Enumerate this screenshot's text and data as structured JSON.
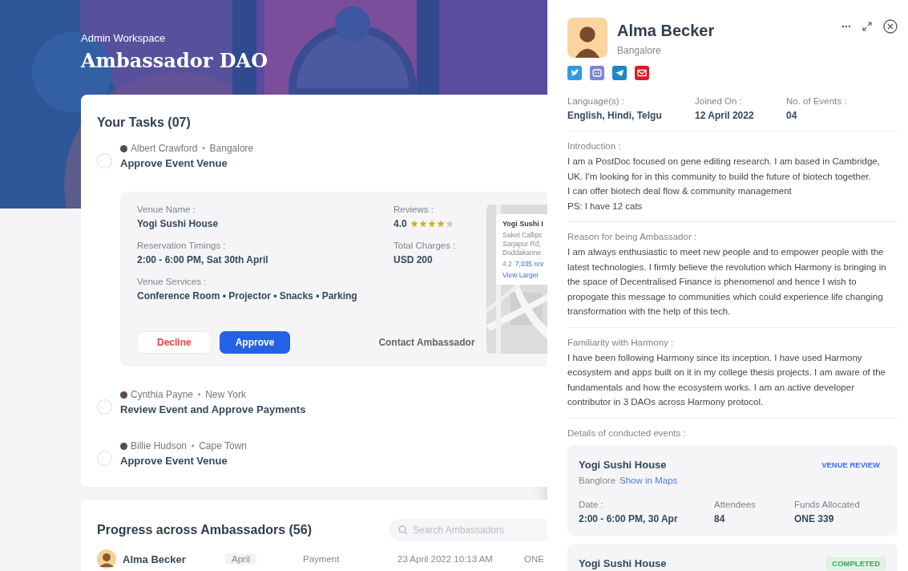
{
  "header": {
    "workspace": "Admin Workspace",
    "title": "Ambassador DAO"
  },
  "tasks_card": {
    "title": "Your Tasks (07)",
    "tasks": [
      {
        "person": "Albert Crawford",
        "separator": "•",
        "city": "Bangalore",
        "title": "Approve Event Venue",
        "checked": false,
        "details": {
          "venue_label": "Venue Name :",
          "venue": "Yogi Sushi House",
          "timing_label": "Reservation Timings :",
          "timing": "2:00 - 6:00 PM, Sat 30th April",
          "services_label": "Venue Services :",
          "services": "Conference Room • Projector • Snacks • Parking",
          "reviews_label": "Reviews :",
          "rating": "4.0",
          "stars": 4,
          "charges_label": "Total Charges :",
          "charges": "USD 200",
          "map_card": {
            "name": "Yogi Sushi I",
            "address": [
              "Saket Callipc",
              "Sarjapur Rd,",
              "Doddakanne"
            ],
            "rating": "4.2",
            "reviews": "7,035 rev",
            "link": "View Larger"
          },
          "decline": "Decline",
          "approve": "Approve",
          "contact": "Contact Ambassador"
        }
      },
      {
        "person": "Cynthia Payne",
        "separator": "•",
        "city": "New York",
        "title": "Review Event and Approve Payments",
        "checked": false
      },
      {
        "person": "Billie Hudson",
        "separator": "•",
        "city": "Cape Town",
        "title": "Approve Event Venue",
        "checked": false
      }
    ]
  },
  "progress_card": {
    "title": "Progress across Ambassadors (56)",
    "search": {
      "placeholder": "Search Ambassadors"
    },
    "rows": [
      {
        "name": "Alma Becker",
        "month": "April",
        "type": "Payment",
        "date": "23 April 2022 10:13 AM",
        "amount": "ONE"
      }
    ]
  },
  "profile": {
    "name": "Alma Becker",
    "city": "Bangalore",
    "info": [
      {
        "label": "Language(s) :",
        "value": "English, Hindi, Telgu"
      },
      {
        "label": "Joined On :",
        "value": "12 April 2022"
      },
      {
        "label": "No. of Events :",
        "value": "04"
      }
    ],
    "sections": [
      {
        "label": "Introduction :",
        "lines": [
          "I am a PostDoc focused on gene editing research. I am based in Cambridge, UK. I'm looking for in this community to build the future of biotech together.",
          "I can offer biotech deal flow & community management",
          "PS: I have 12 cats"
        ]
      },
      {
        "label": "Reason for being Ambassador :",
        "lines": [
          "I am always enthusiastic to meet new people and to empower people with the latest technologies. I firmly believe the revolution which Harmony is bringing in the space of Decentralised Finance is phenomenol and hence I wish to propogate this message to communities which could experience life changing transformation with the help of this tech."
        ]
      },
      {
        "label": "Familiarity with Harmony :",
        "lines": [
          "I have been following Harmony since its inception. I have used Harmony ecosystem and apps built on it in my college thesis projects. I am aware of the fundamentals and how the ecosystem works. I am an active developer contributor in 3 DAOs across Harmony protocol."
        ]
      }
    ],
    "events_label": "Details of conducted events :",
    "events": [
      {
        "name": "Yogi Sushi House",
        "status": "VENUE REVIEW",
        "kind": "review",
        "city": "Banglore",
        "maps_link": "Show in Maps",
        "fields": [
          {
            "label": "Date :",
            "value": "2:00 - 6:00 PM, 30 Apr"
          },
          {
            "label": "Attendees",
            "value": "84"
          },
          {
            "label": "Funds Allocated",
            "value": "ONE 339"
          }
        ]
      },
      {
        "name": "Yogi Sushi House",
        "status": "COMPLETED",
        "kind": "completed"
      }
    ]
  }
}
